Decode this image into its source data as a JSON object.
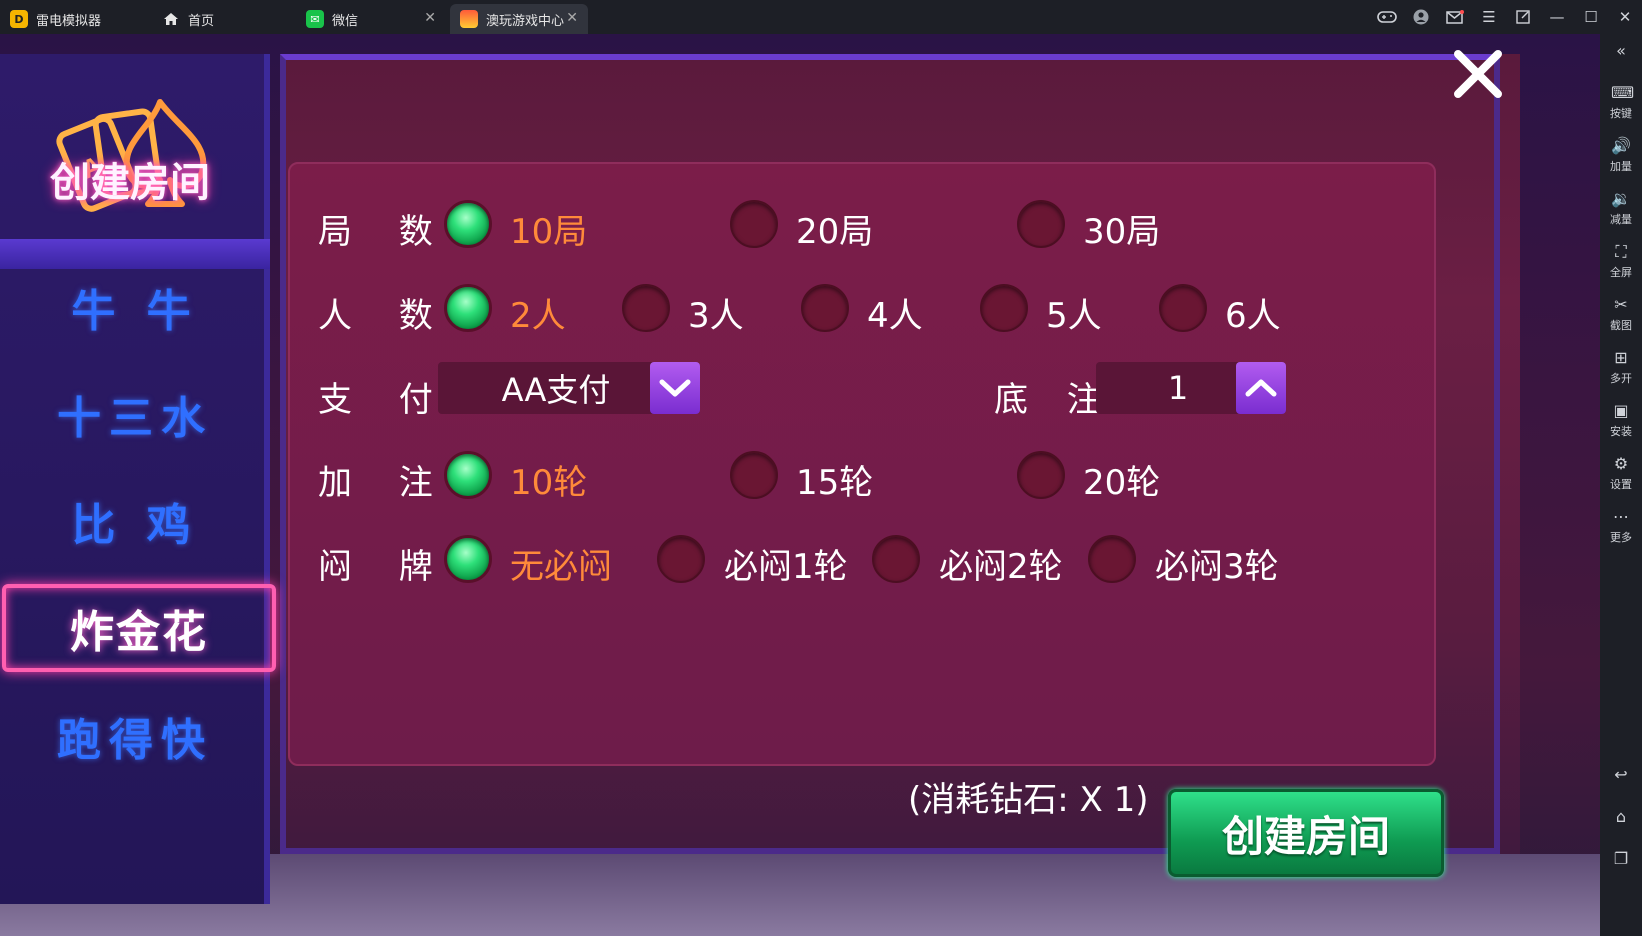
{
  "titlebar": {
    "tabs": [
      {
        "label": "雷电模拟器",
        "icon": "ld-logo-icon"
      },
      {
        "label": "首页",
        "icon": "home-icon"
      },
      {
        "label": "微信",
        "icon": "wechat-icon"
      },
      {
        "label": "澳玩游戏中心",
        "icon": "game-center-icon"
      }
    ]
  },
  "right_toolbar": [
    {
      "label": "按键",
      "icon": "keyboard-icon"
    },
    {
      "label": "加量",
      "icon": "volume-up-icon"
    },
    {
      "label": "减量",
      "icon": "volume-down-icon"
    },
    {
      "label": "全屏",
      "icon": "fullscreen-icon"
    },
    {
      "label": "截图",
      "icon": "scissors-icon"
    },
    {
      "label": "多开",
      "icon": "multi-open-icon"
    },
    {
      "label": "安装",
      "icon": "apk-install-icon"
    },
    {
      "label": "设置",
      "icon": "settings-icon"
    },
    {
      "label": "更多",
      "icon": "more-icon"
    }
  ],
  "left_panel": {
    "title": "创建房间",
    "games": [
      "牛 牛",
      "十三水",
      "比 鸡",
      "炸金花",
      "跑得快"
    ],
    "selected": "炸金花"
  },
  "settings": {
    "rounds": {
      "label": "局 数:",
      "options": [
        "10局",
        "20局",
        "30局"
      ],
      "selected": "10局"
    },
    "players": {
      "label": "人 数:",
      "options": [
        "2人",
        "3人",
        "4人",
        "5人",
        "6人"
      ],
      "selected": "2人"
    },
    "payment": {
      "label": "支 付:",
      "value": "AA支付"
    },
    "base_bet": {
      "label": "底 注:",
      "value": "1"
    },
    "raise": {
      "label": "加 注:",
      "options": [
        "10轮",
        "15轮",
        "20轮"
      ],
      "selected": "10轮"
    },
    "blind": {
      "label": "闷 牌:",
      "options": [
        "无必闷",
        "必闷1轮",
        "必闷2轮",
        "必闷3轮"
      ],
      "selected": "无必闷"
    }
  },
  "cost_text": "(消耗钻石: X 1)",
  "create_button": "创建房间",
  "colors": {
    "accent_selected": "#ff8a3a",
    "radio_on": "#2ee07a",
    "panel": "#7b1d49",
    "button": "#18b060"
  }
}
